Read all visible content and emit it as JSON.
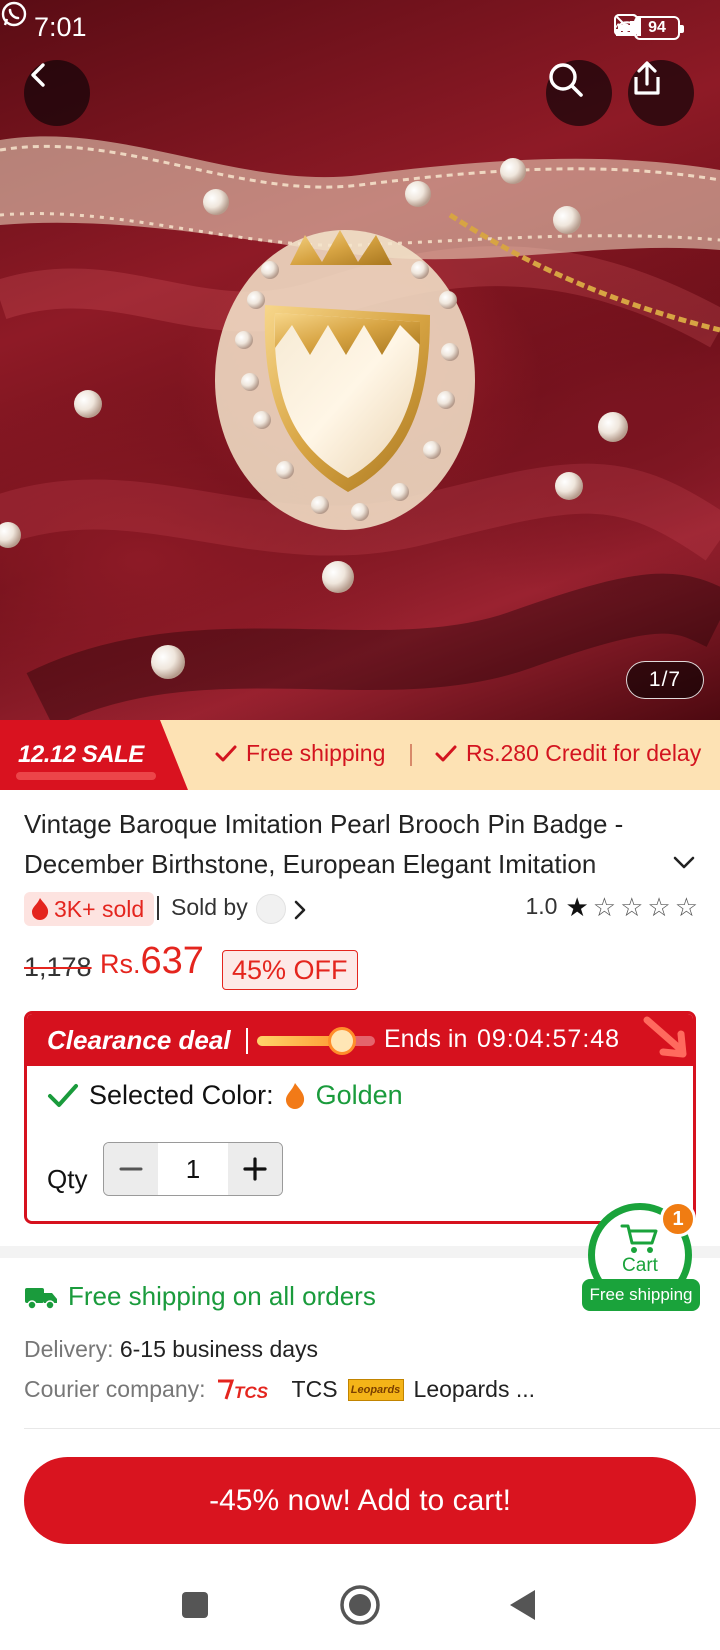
{
  "status_bar": {
    "time": "7:01",
    "battery": "94",
    "network_label": "4G"
  },
  "gallery": {
    "counter": "1/7",
    "icons": [
      "back-arrow-icon",
      "search-icon",
      "share-icon"
    ]
  },
  "promo": {
    "sale_label": "12.12 SALE",
    "free_shipping": "Free shipping",
    "credit": "Rs.280 Credit for delay"
  },
  "product": {
    "title": "Vintage Baroque Imitation Pearl Brooch Pin Badge - December Birthstone, European Elegant Imitation",
    "sold": "3K+ sold",
    "sold_by": "Sold by",
    "rating": "1.0",
    "rating_stars": 1,
    "price_old": "1,178",
    "currency": "Rs.",
    "price": "637",
    "discount": "45% OFF"
  },
  "clearance": {
    "title": "Clearance deal",
    "progress": 0.72,
    "ends_in_label": "Ends in",
    "timer": "09:04:57:48",
    "selected_color_label": "Selected Color:",
    "selected_color": "Golden",
    "qty_label": "Qty",
    "qty": "1"
  },
  "shipping": {
    "headline": "Free shipping on all orders",
    "delivery_label": "Delivery:",
    "delivery_value": "6-15 business days",
    "courier_label": "Courier company:",
    "courier_1": "TCS",
    "courier_2": "Leopards ...",
    "logo_tcs": "TCS",
    "logo_leopards": "Leopards"
  },
  "floating_cart": {
    "label": "Cart",
    "badge": "1",
    "tag": "Free shipping"
  },
  "cta": {
    "add_to_cart": "-45% now! Add to cart!"
  },
  "colors": {
    "accent_red": "#d9141f",
    "green": "#1a9b3c",
    "promo_bg": "#fde2b4"
  }
}
